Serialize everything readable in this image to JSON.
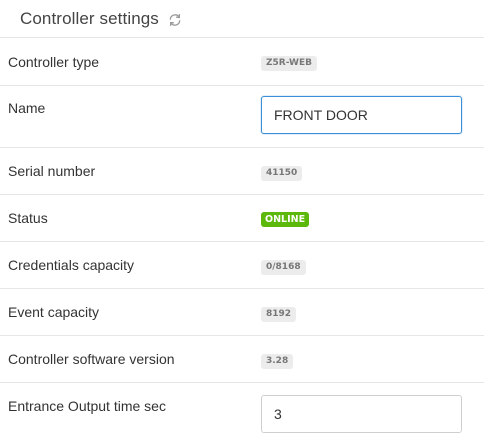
{
  "header": {
    "title": "Controller settings",
    "refresh_icon": "refresh-icon"
  },
  "rows": {
    "controller_type": {
      "label": "Controller type",
      "value": "Z5R-WEB"
    },
    "name": {
      "label": "Name",
      "value": "FRONT DOOR"
    },
    "serial_number": {
      "label": "Serial number",
      "value": "41150"
    },
    "status": {
      "label": "Status",
      "value": "ONLINE",
      "color": "#5cb80a"
    },
    "credentials_capacity": {
      "label": "Credentials capacity",
      "value": "0/8168"
    },
    "event_capacity": {
      "label": "Event capacity",
      "value": "8192"
    },
    "software_version": {
      "label": "Controller software version",
      "value": "3.28"
    },
    "entrance_output_time": {
      "label": "Entrance Output time sec",
      "value": "3"
    }
  },
  "colors": {
    "focus_border": "#3a8fd6",
    "divider": "#e6e6e6",
    "badge_bg": "#ececec"
  }
}
